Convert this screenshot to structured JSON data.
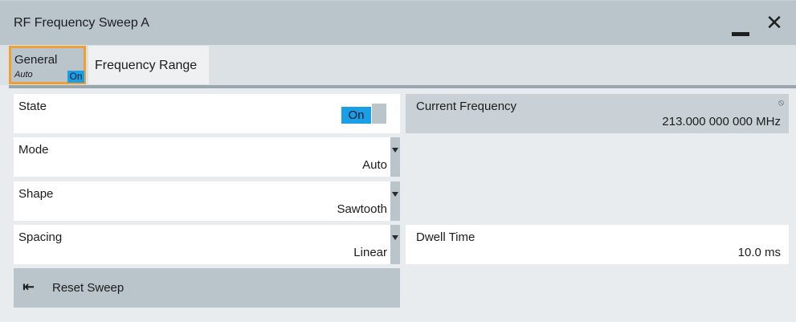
{
  "window": {
    "title": "RF Frequency Sweep A",
    "minimize_icon": "minimize-icon",
    "close_icon": "close-icon",
    "close_glyph": "✕"
  },
  "tabs": [
    {
      "label": "General",
      "sub_label": "Auto",
      "badge": "On",
      "selected": true
    },
    {
      "label": "Frequency Range",
      "selected": false
    }
  ],
  "fields": {
    "state": {
      "label": "State",
      "value": "On"
    },
    "mode": {
      "label": "Mode",
      "value": "Auto",
      "options_icon": "dropdown-arrow-icon"
    },
    "shape": {
      "label": "Shape",
      "value": "Sawtooth",
      "options_icon": "dropdown-arrow-icon"
    },
    "spacing": {
      "label": "Spacing",
      "value": "Linear",
      "options_icon": "dropdown-arrow-icon"
    },
    "current_frequency": {
      "label": "Current Frequency",
      "value": "213.000 000 000 MHz",
      "readonly": true,
      "icon": "readonly-icon"
    },
    "dwell_time": {
      "label": "Dwell Time",
      "value": "10.0 ms"
    }
  },
  "reset_button": {
    "label": "Reset Sweep",
    "icon": "reset-arrow-icon",
    "glyph": "⇤"
  },
  "colors": {
    "accent_on": "#1a9ee6",
    "tab_highlight": "#f0a030",
    "titlebar": "#b9c4cb"
  }
}
